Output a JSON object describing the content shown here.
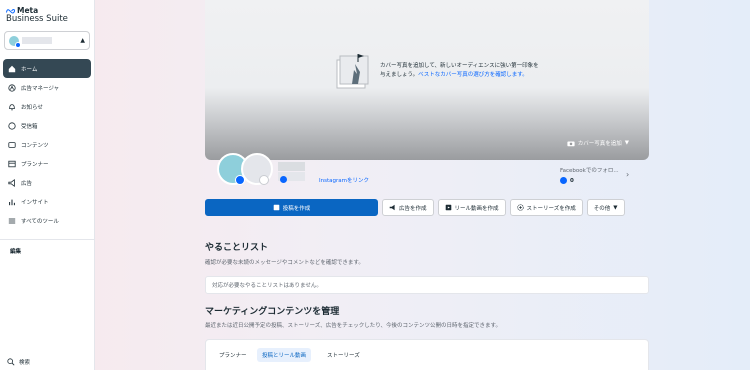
{
  "app": {
    "brand": "Meta",
    "product": "Business Suite"
  },
  "sidebar": {
    "items": [
      {
        "label": "ホーム",
        "icon": "home-icon",
        "active": true
      },
      {
        "label": "広告マネージャ",
        "icon": "ads-manager-icon"
      },
      {
        "label": "お知らせ",
        "icon": "bell-icon"
      },
      {
        "label": "受信箱",
        "icon": "inbox-icon"
      },
      {
        "label": "コンテンツ",
        "icon": "content-icon"
      },
      {
        "label": "プランナー",
        "icon": "planner-icon"
      },
      {
        "label": "広告",
        "icon": "megaphone-icon"
      },
      {
        "label": "インサイト",
        "icon": "chart-icon"
      },
      {
        "label": "すべてのツール",
        "icon": "menu-icon"
      }
    ],
    "edit_label": "編集",
    "search_label": "検索"
  },
  "cover": {
    "text_plain": "カバー写真を追加して、新しいオーディエンスに強い第一印象を与えましょう。",
    "text_link": "ベストなカバー写真の選び方を確認します。",
    "add_button": "カバー写真を追加"
  },
  "profile": {
    "instagram_link": "Instagramをリンク",
    "fb_followers_label": "Facebookでのフォロ...",
    "fb_followers_count": "0"
  },
  "actions": {
    "create_post": "投稿を作成",
    "create_ad": "広告を作成",
    "create_reel": "リール動画を作成",
    "create_story": "ストーリーズを作成",
    "more": "その他"
  },
  "todo": {
    "title": "やることリスト",
    "subtitle": "確認が必要な未読のメッセージやコメントなどを確認できます。",
    "empty": "対応が必要なやることリストはありません。"
  },
  "marketing": {
    "title": "マーケティングコンテンツを管理",
    "subtitle": "最近または近日公開予定の投稿、ストーリーズ、広告をチェックしたり、今後のコンテンツ公開の日時を指定できます。",
    "tabs": [
      "プランナー",
      "投稿とリール動画",
      "ストーリーズ"
    ]
  },
  "colors": {
    "primary": "#0a66c2",
    "facebook": "#0866ff",
    "sidebar_active": "#344854"
  }
}
